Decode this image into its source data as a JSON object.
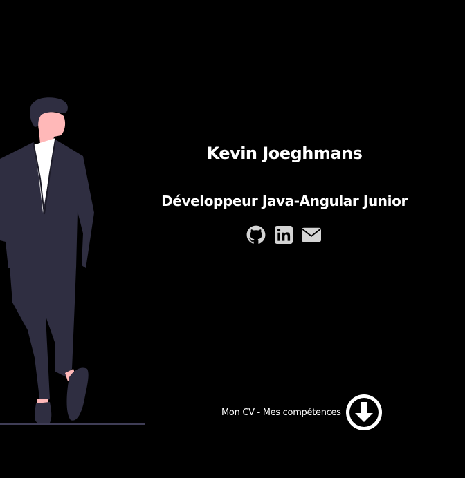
{
  "hero": {
    "name": "Kevin Joeghmans",
    "role": "Développeur Java-Angular Junior"
  },
  "socials": [
    {
      "icon": "github-icon"
    },
    {
      "icon": "linkedin-icon"
    },
    {
      "icon": "envelope-icon"
    }
  ],
  "cv_link": {
    "label": "Mon CV - Mes compétences",
    "icon": "arrow-down-circle-icon"
  },
  "colors": {
    "background": "#000000",
    "text": "#ffffff",
    "icon": "#d4d4d4",
    "suit": "#2f2e41",
    "skin": "#ffb8b8"
  }
}
